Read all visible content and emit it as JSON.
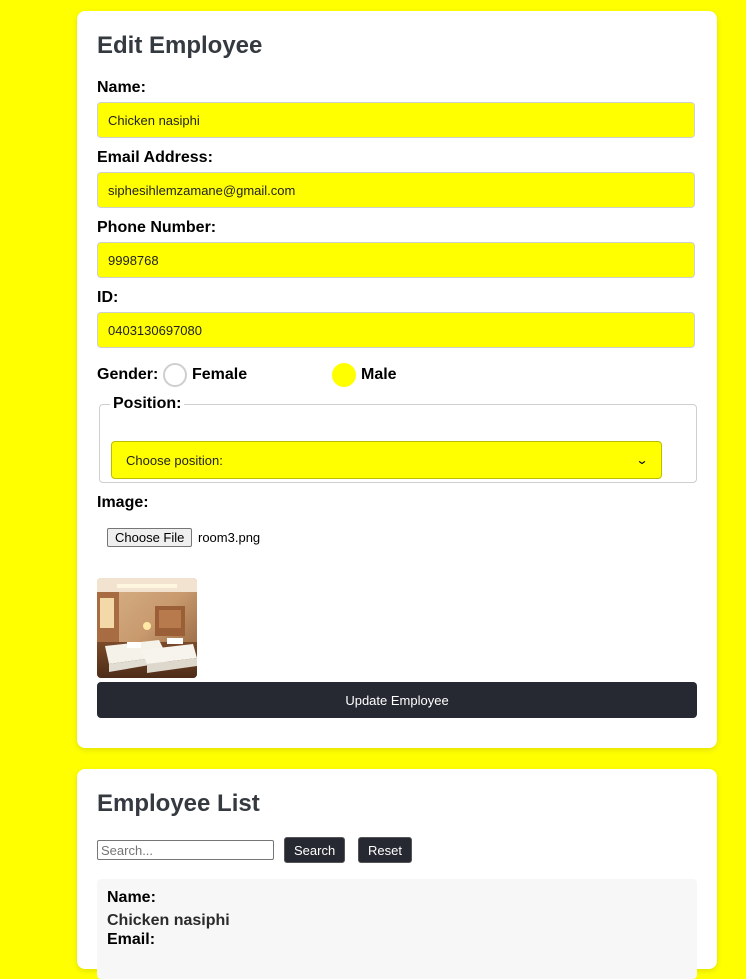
{
  "edit_form": {
    "title": "Edit Employee",
    "name": {
      "label": "Name:",
      "value": "Chicken nasiphi"
    },
    "email": {
      "label": "Email Address:",
      "value": "siphesihlemzamane@gmail.com"
    },
    "phone": {
      "label": "Phone Number:",
      "value": "9998768"
    },
    "id": {
      "label": "ID:",
      "value": "0403130697080"
    },
    "gender": {
      "label": "Gender:",
      "options": [
        {
          "label": "Female",
          "selected": false
        },
        {
          "label": "Male",
          "selected": true
        }
      ]
    },
    "position": {
      "legend": "Position:",
      "selected": "Choose position:"
    },
    "image": {
      "label": "Image:",
      "button": "Choose File",
      "file_name": "room3.png",
      "thumbnail": "hotel-room-photo"
    },
    "submit_label": "Update Employee"
  },
  "employee_list": {
    "title": "Employee List",
    "search": {
      "placeholder": "Search...",
      "value": ""
    },
    "search_button": "Search",
    "reset_button": "Reset",
    "items": [
      {
        "name_label": "Name:",
        "name": "Chicken nasiphi",
        "email_label": "Email:"
      }
    ]
  },
  "colors": {
    "page_background": "#ffff00",
    "input_background": "#ffff00",
    "button_dark": "#262932",
    "title_text": "#343a40"
  }
}
